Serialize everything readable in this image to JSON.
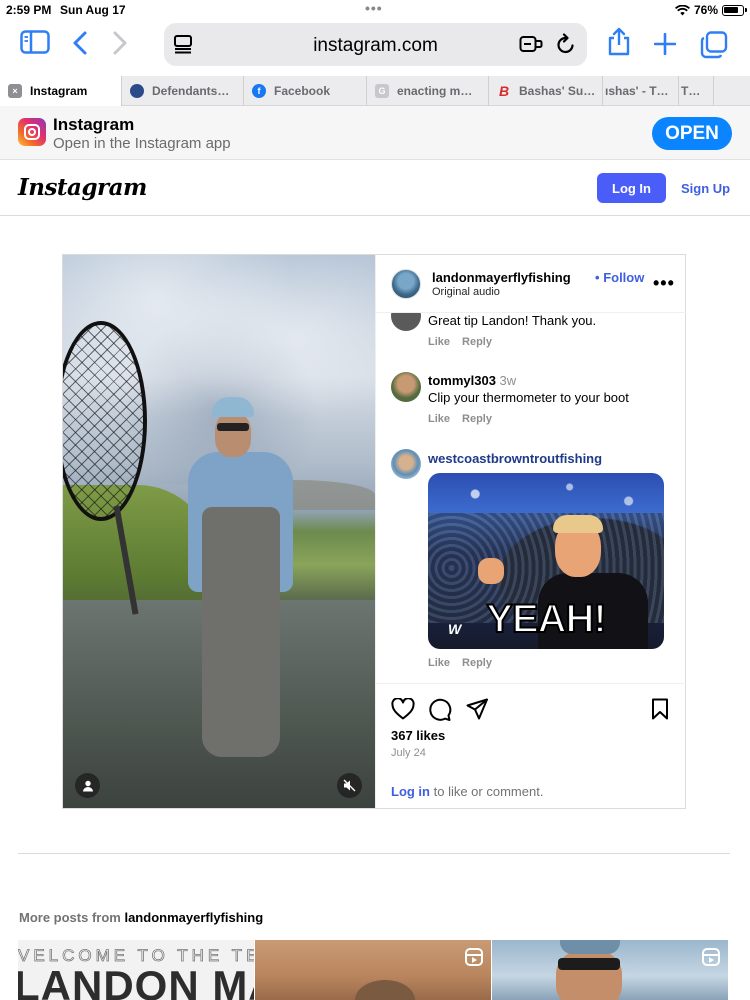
{
  "status_bar": {
    "time": "2:59 PM",
    "date": "Sun Aug 17",
    "battery": "76%"
  },
  "browser": {
    "url": "instagram.com",
    "tabs": [
      {
        "label": "Instagram",
        "icon": "close-icon",
        "active": true
      },
      {
        "label": "Defendants…",
        "icon": "seal-favicon",
        "active": false
      },
      {
        "label": "Facebook",
        "icon": "facebook-favicon",
        "active": false
      },
      {
        "label": "enacting m…",
        "icon": "g-favicon",
        "active": false
      },
      {
        "label": "Bashas' Su…",
        "icon": "bashas-favicon",
        "active": false
      },
      {
        "label": "ıshas' - T…",
        "icon": "",
        "active": false
      },
      {
        "label": "T…",
        "icon": "",
        "active": false
      }
    ]
  },
  "app_banner": {
    "title": "Instagram",
    "subtitle": "Open in the Instagram app",
    "button": "OPEN"
  },
  "header": {
    "logo": "Instagram",
    "login": "Log In",
    "signup": "Sign Up"
  },
  "post": {
    "username": "landonmayerflyfishing",
    "separator": "•",
    "follow": "Follow",
    "audio": "Original audio",
    "comments": [
      {
        "user": "",
        "text": "Great tip Landon! Thank you.",
        "time": "",
        "like": "Like",
        "reply": "Reply"
      },
      {
        "user": "tommyl303",
        "text": "Clip your thermometer to your boot",
        "time": "3w",
        "like": "Like",
        "reply": "Reply"
      },
      {
        "user": "westcoastbrowntroutfishing",
        "text": "",
        "time": "",
        "gif_caption": "YEAH!",
        "gif_logo": "W",
        "like": "Like",
        "reply": "Reply"
      }
    ],
    "likes": "367 likes",
    "date": "July 24",
    "login_link": "Log in",
    "login_text": " to like or comment."
  },
  "more_posts": {
    "prefix": "More posts from ",
    "username": "landonmayerflyfishing",
    "thumb1_line1": "VELCOME TO THE TEAM",
    "thumb1_line2": "LANDON MAYER"
  },
  "colors": {
    "link_blue": "#3f5fe0",
    "login_button": "#4a5df9",
    "safari_blue": "#2f7ef6",
    "open_button": "#0a84ff"
  }
}
